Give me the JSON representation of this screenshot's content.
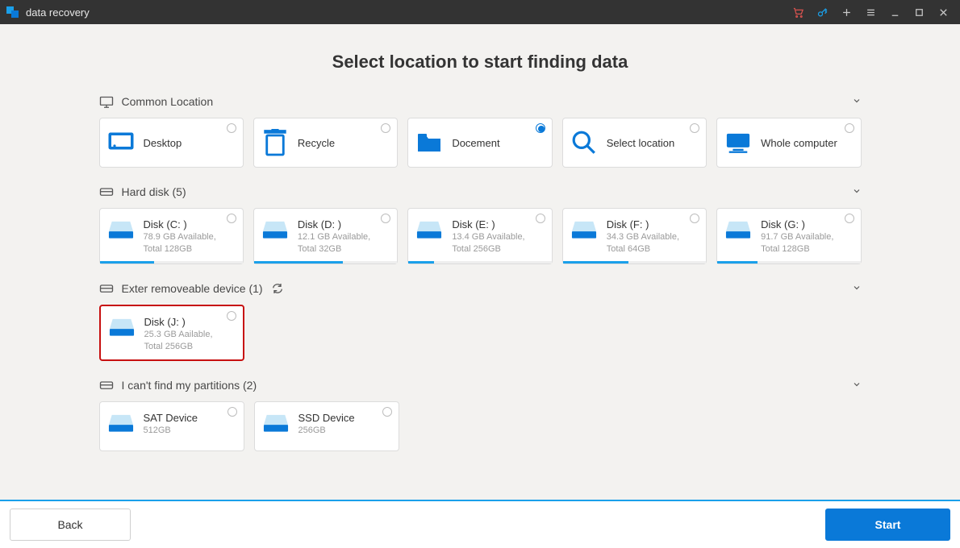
{
  "titlebar": {
    "title": "data recovery"
  },
  "heading": "Select location to  start finding data",
  "sections": {
    "common": {
      "label": "Common Location",
      "items": [
        {
          "label": "Desktop",
          "selected": false
        },
        {
          "label": "Recycle",
          "selected": false
        },
        {
          "label": "Docement",
          "selected": true
        },
        {
          "label": "Select location",
          "selected": false
        },
        {
          "label": "Whole computer",
          "selected": false
        }
      ]
    },
    "hard_disk": {
      "label": "Hard disk (5)",
      "items": [
        {
          "name": "Disk (C: )",
          "line1": "78.9 GB Available,",
          "line2": "Total 128GB",
          "fill": 38
        },
        {
          "name": "Disk (D: )",
          "line1": "12.1 GB Available,",
          "line2": "Total 32GB",
          "fill": 62
        },
        {
          "name": "Disk (E: )",
          "line1": "13.4 GB Available,",
          "line2": "Total 256GB",
          "fill": 18
        },
        {
          "name": "Disk (F: )",
          "line1": "34.3 GB Available,",
          "line2": "Total 64GB",
          "fill": 46
        },
        {
          "name": "Disk (G: )",
          "line1": "91.7 GB Available,",
          "line2": "Total 128GB",
          "fill": 28
        }
      ]
    },
    "removable": {
      "label": "Exter removeable device (1)",
      "items": [
        {
          "name": "Disk (J: )",
          "line1": "25.3 GB Aailable,",
          "line2": "Total 256GB",
          "highlight": true
        }
      ]
    },
    "lost": {
      "label": "I can't find my partitions (2)",
      "items": [
        {
          "name": "SAT Device",
          "line1": "512GB"
        },
        {
          "name": "SSD Device",
          "line1": "256GB"
        }
      ]
    }
  },
  "footer": {
    "back": "Back",
    "start": "Start"
  }
}
